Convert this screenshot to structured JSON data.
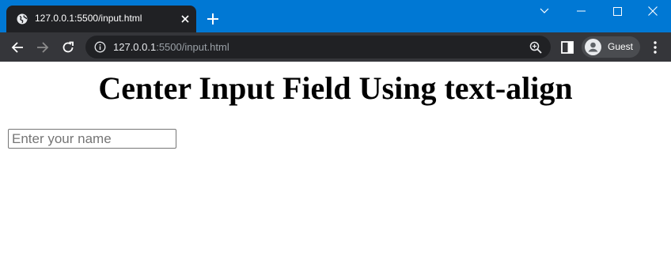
{
  "browser": {
    "tab": {
      "title": "127.0.0.1:5500/input.html"
    },
    "address_bar": {
      "host": "127.0.0.1",
      "path": ":5500/input.html"
    },
    "profile": {
      "name": "Guest"
    },
    "colors": {
      "tabstrip": "#0078d4",
      "toolbar": "#35363a",
      "omnibox": "#202124"
    }
  },
  "page": {
    "heading": "Center Input Field Using text-align",
    "name_input": {
      "placeholder": "Enter your name",
      "value": ""
    }
  }
}
